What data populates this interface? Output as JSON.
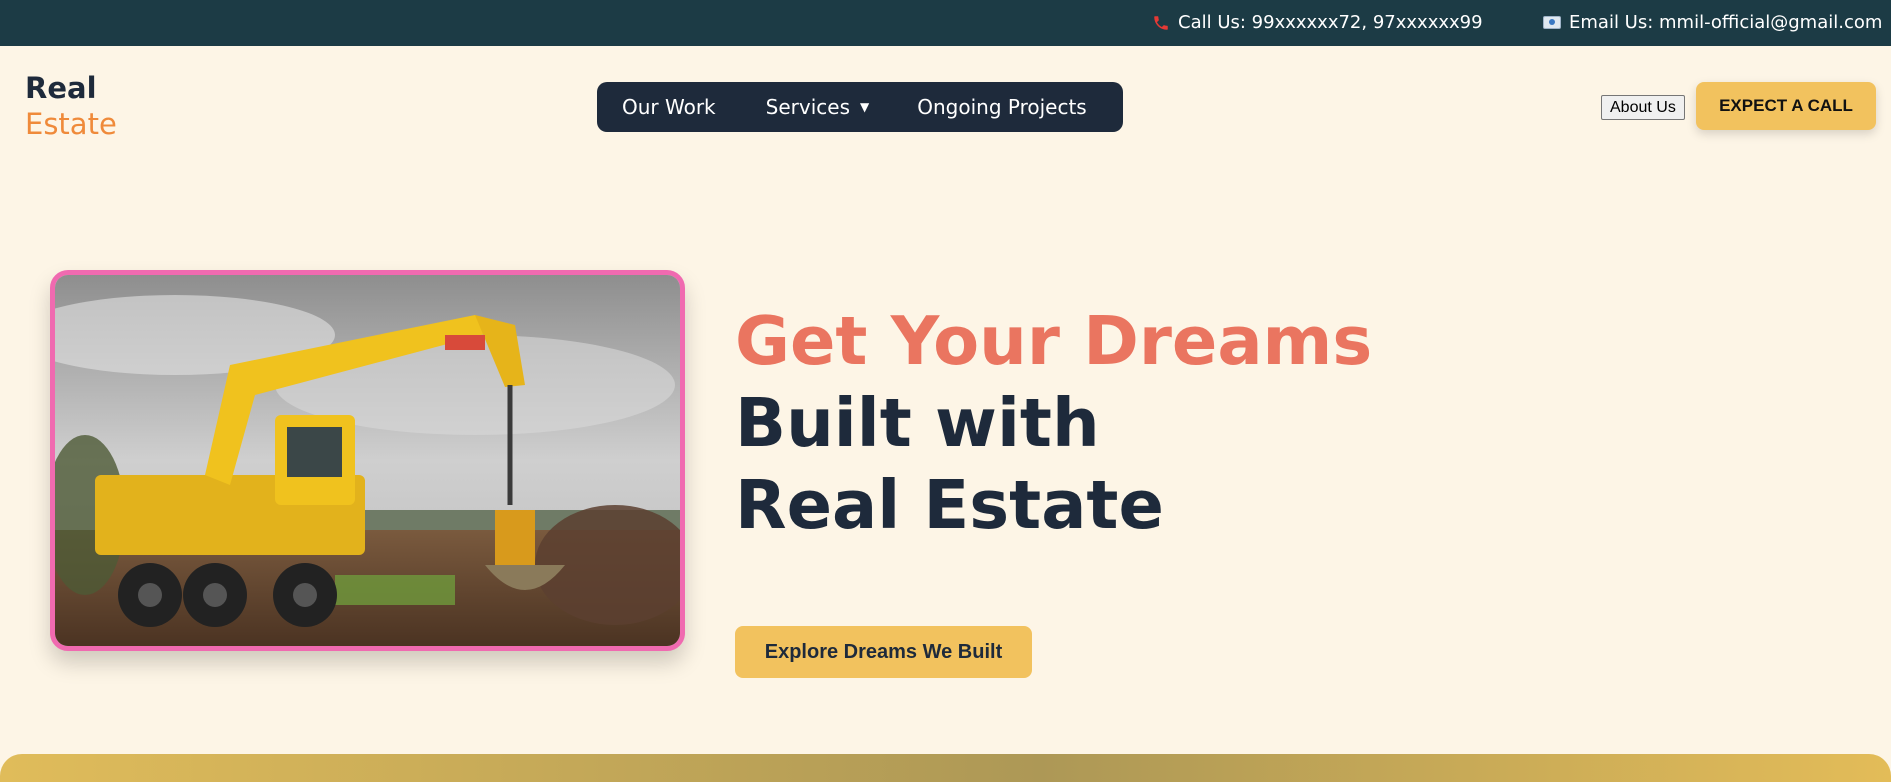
{
  "topbar": {
    "phone_text": "Call Us: 99xxxxxx72, 97xxxxxx99",
    "email_text": "Email Us: mmil-official@gmail.com",
    "phone_icon": "phone-icon",
    "email_icon": "email-icon"
  },
  "header": {
    "logo_line1": "Real",
    "logo_line2": "Estate",
    "nav": {
      "our_work": "Our Work",
      "services": "Services",
      "services_caret": "▼",
      "ongoing_projects": "Ongoing Projects"
    },
    "about_label": "About Us",
    "call_label": "EXPECT A CALL"
  },
  "hero": {
    "line1": "Get Your Dreams",
    "line2": "Built with",
    "line3": "Real Estate",
    "cta_label": "Explore Dreams We Built",
    "image_name": "excavator-photo"
  },
  "colors": {
    "topbar_bg": "#1c3b45",
    "page_bg": "#fdf5e6",
    "navy": "#1e2a3b",
    "accent_orange": "#ef8a3a",
    "headline_coral": "#ea7560",
    "button_yellow": "#f2c25e",
    "image_border_pink": "#f06ab0"
  }
}
